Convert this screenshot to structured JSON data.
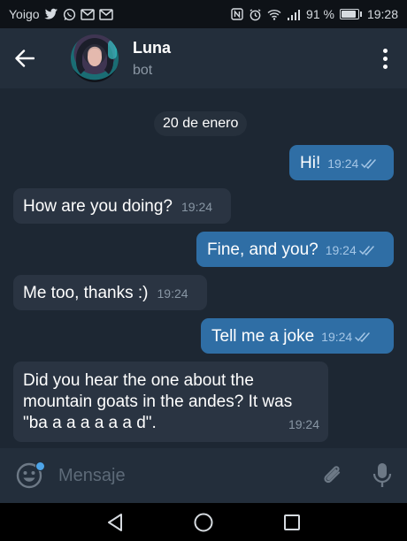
{
  "status_bar": {
    "carrier": "Yoigo",
    "battery_percent": "91 %",
    "battery_level": 0.91,
    "time": "19:28"
  },
  "header": {
    "name": "Luna",
    "subtitle": "bot"
  },
  "chat": {
    "date": "20 de enero",
    "messages": [
      {
        "direction": "outgoing",
        "text": "Hi!",
        "time": "19:24",
        "status": "read"
      },
      {
        "direction": "incoming",
        "text": "How are you doing?",
        "time": "19:24"
      },
      {
        "direction": "outgoing",
        "text": "Fine, and you?",
        "time": "19:24",
        "status": "read"
      },
      {
        "direction": "incoming",
        "text": "Me too, thanks :)",
        "time": "19:24"
      },
      {
        "direction": "outgoing",
        "text": "Tell me a joke",
        "time": "19:24",
        "status": "read"
      },
      {
        "direction": "incoming",
        "text": "Did you hear the one about the mountain goats in the andes? It was \"ba a a a a a a d\".",
        "time": "19:24"
      }
    ]
  },
  "input": {
    "placeholder": "Mensaje"
  },
  "colors": {
    "background": "#1d2733",
    "header": "#232e3b",
    "outgoing_bubble": "#2f6ea5",
    "incoming_bubble": "#2a3442",
    "accent": "#4da4e8"
  }
}
